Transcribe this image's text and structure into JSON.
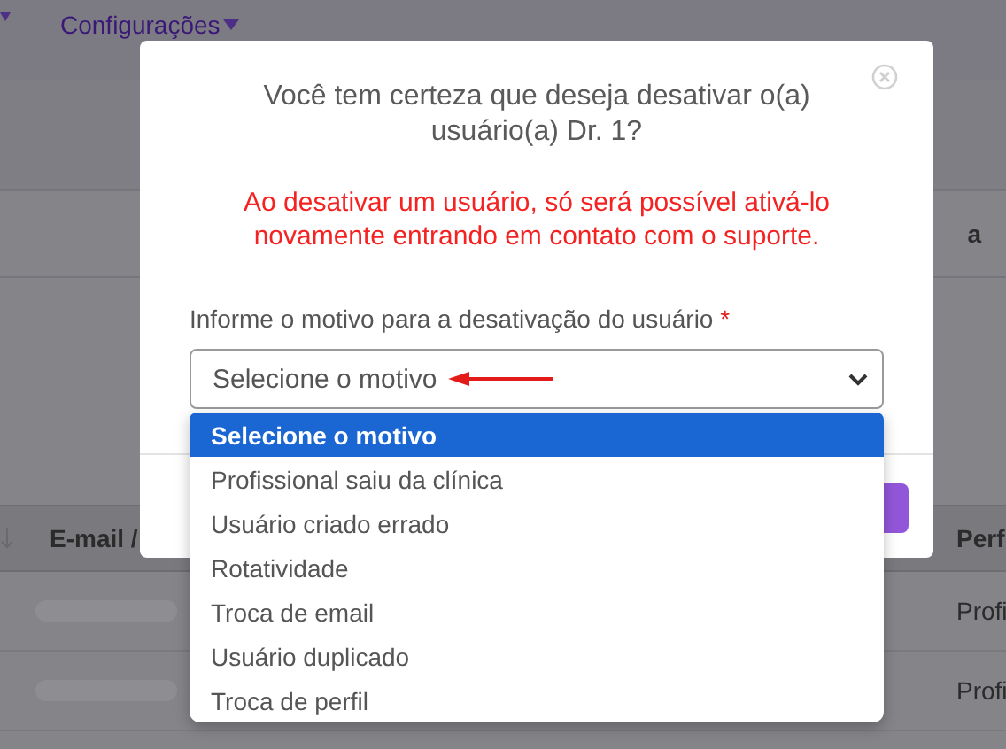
{
  "nav": {
    "menu": "Configurações"
  },
  "background": {
    "column_heading": "a",
    "table": {
      "columns": [
        "E-mail /",
        "Perf"
      ],
      "rows": [
        {
          "column_2": "Profi"
        },
        {
          "column_2": "Profi"
        }
      ]
    }
  },
  "modal": {
    "title": "Você tem certeza que deseja desativar o(a) usuário(a) Dr. 1?",
    "warning": "Ao desativar um usuário, só será possível ativá-lo novamente entrando em contato com o suporte.",
    "field_label": "Informe o motivo para a desativação do usuário",
    "required_mark": "*",
    "select_value": "Selecione o motivo",
    "options": [
      {
        "label": "Selecione o motivo",
        "selected": true
      },
      {
        "label": "Profissional saiu da clínica",
        "selected": false
      },
      {
        "label": "Usuário criado errado",
        "selected": false
      },
      {
        "label": "Rotatividade",
        "selected": false
      },
      {
        "label": "Troca de email",
        "selected": false
      },
      {
        "label": "Usuário duplicado",
        "selected": false
      },
      {
        "label": "Troca de perfil",
        "selected": false
      }
    ]
  }
}
